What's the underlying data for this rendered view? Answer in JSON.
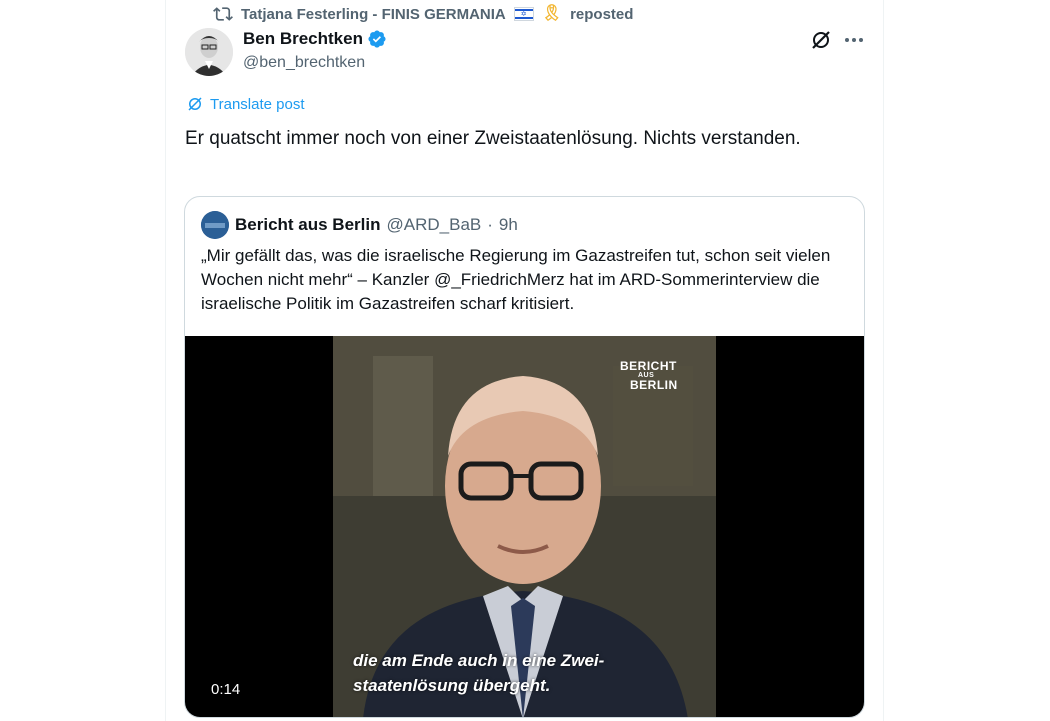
{
  "repost": {
    "reposter_name": "Tatjana Festerling - FINIS GERMANIA",
    "suffix": "reposted",
    "icons": [
      "repost-icon",
      "israel-flag-icon",
      "yellow-ribbon-icon"
    ]
  },
  "author": {
    "name": "Ben Brechtken",
    "handle": "@ben_brechtken",
    "verified_color": "#1d9bf0"
  },
  "actions": {
    "icons": [
      "grok-icon",
      "more-icon"
    ]
  },
  "translate_label": "Translate post",
  "post_text": "Er quatscht immer noch von einer Zweistaatenlösung. Nichts verstanden.",
  "quote": {
    "name": "Bericht aus Berlin",
    "handle": "@ARD_BaB",
    "separator": "·",
    "time": "9h",
    "text": "„Mir gefällt das, was die israelische Regierung im Gazastreifen tut, schon seit vielen Wochen nicht mehr“ – Kanzler @_FriedrichMerz hat im ARD-Sommerinterview die israelische Politik im Gazastreifen scharf kritisiert.",
    "video": {
      "logo_line1": "BERICHT",
      "logo_line2": "AUS",
      "logo_line3": "BERLIN",
      "caption": "die am Ende auch in eine Zwei-staatenlösung übergeht.",
      "caption_line1": "die am Ende auch in eine Zwei-",
      "caption_line2": "staatenlösung übergeht.",
      "timestamp": "0:14"
    }
  },
  "colors": {
    "text": "#0f1419",
    "secondary": "#536471",
    "accent": "#1d9bf0",
    "border": "#cfd9de"
  }
}
